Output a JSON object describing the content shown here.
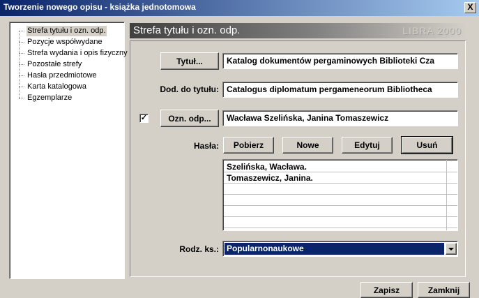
{
  "window": {
    "title": "Tworzenie nowego opisu - książka jednotomowa",
    "close_label": "X"
  },
  "tree": {
    "items": [
      {
        "label": "Strefa tytułu i ozn. odp.",
        "selected": true
      },
      {
        "label": "Pozycje współwydane",
        "selected": false
      },
      {
        "label": "Strefa wydania i opis fizyczny",
        "selected": false
      },
      {
        "label": "Pozostałe strefy",
        "selected": false
      },
      {
        "label": "Hasła przedmiotowe",
        "selected": false
      },
      {
        "label": "Karta katalogowa",
        "selected": false
      },
      {
        "label": "Egzemplarze",
        "selected": false
      }
    ]
  },
  "header": {
    "title": "Strefa tytułu i ozn. odp.",
    "brand": "LIBRA 2000"
  },
  "form": {
    "tytul_button": "Tytuł...",
    "tytul_value": "Katalog dokumentów pergaminowych Biblioteki Cza",
    "dod_label": "Dod. do tytułu:",
    "dod_value": "Catalogus diplomatum pergameneorum Bibliotheca",
    "ozn_checkbox_mark": "✓",
    "ozn_button": "Ozn. odp...",
    "ozn_value": "Wacława Szelińska, Janina Tomaszewicz",
    "hasla_label": "Hasła:",
    "hasla_buttons": {
      "pobierz": "Pobierz",
      "nowe": "Nowe",
      "edytuj": "Edytuj",
      "usun": "Usuń"
    },
    "hasla_list": [
      "Szelińska, Wacława.",
      "Tomaszewicz, Janina."
    ],
    "rodz_label": "Rodz. ks.:",
    "rodz_value": "Popularnonaukowe"
  },
  "footer": {
    "zapisz": "Zapisz",
    "zamknij": "Zamknij"
  },
  "colors": {
    "titlebar": "#0a246a",
    "selection": "#0a246a",
    "face": "#d4d0c8"
  }
}
